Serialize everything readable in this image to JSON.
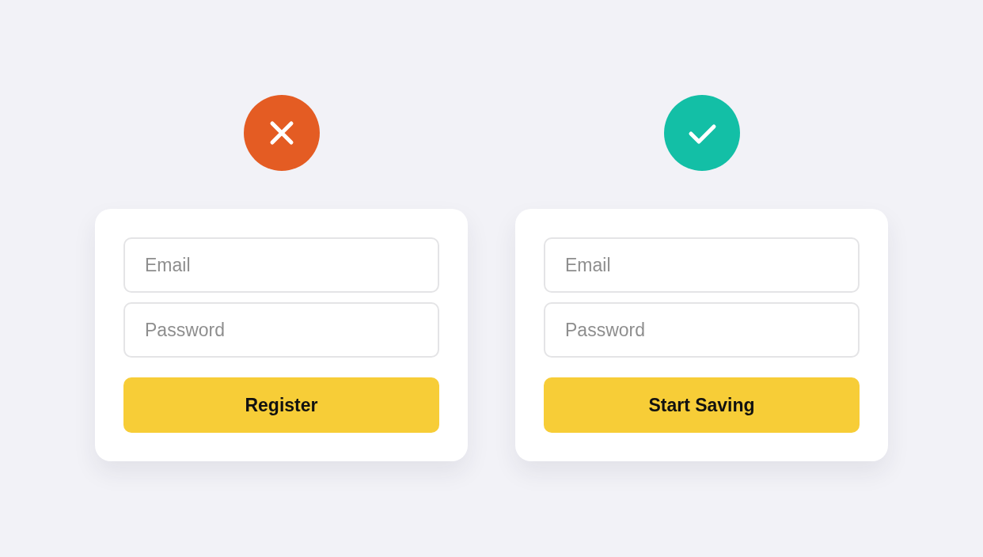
{
  "panels": [
    {
      "verdict": {
        "kind": "cross",
        "color": "#e45c23"
      },
      "form": {
        "fields": [
          {
            "placeholder": "Email"
          },
          {
            "placeholder": "Password"
          }
        ],
        "button": "Register"
      }
    },
    {
      "verdict": {
        "kind": "check",
        "color": "#13bfa6"
      },
      "form": {
        "fields": [
          {
            "placeholder": "Email"
          },
          {
            "placeholder": "Password"
          }
        ],
        "button": "Start Saving"
      }
    }
  ]
}
